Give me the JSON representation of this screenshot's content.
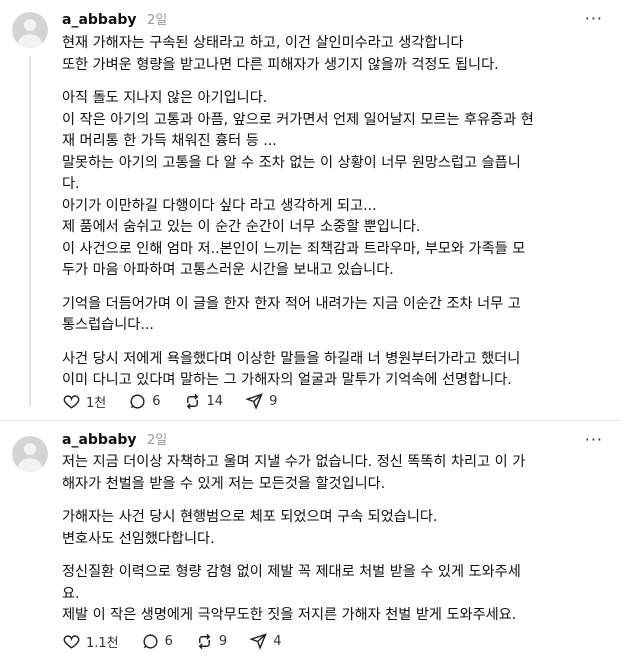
{
  "posts": [
    {
      "username": "a_abbaby",
      "time": "2일",
      "more_label": "···",
      "paragraphs": [
        {
          "lines": [
            "현재 가해자는 구속된 상태라고 하고, 이건 살인미수라고 생각합니다",
            "또한 가벼운 형량을 받고나면 다른 피해자가 생기지 않을까 걱정도 됩니다."
          ]
        },
        {
          "lines": [
            "아직 돌도 지나지 않은 아기입니다.",
            "이 작은 아기의 고통과 아픔, 앞으로 커가면서 언제 일어날지 모르는 후유증과 현",
            "재 머리통 한 가득 채워진 흉터 등 ...",
            "말못하는 아기의 고통을 다 알 수 조차 없는 이 상황이 너무 원망스럽고 슬픕니",
            "다.",
            "아기가 이만하길 다행이다 싶다 라고 생각하게 되고...",
            "제 품에서 숨쉬고 있는 이 순간 순간이 너무 소중할 뿐입니다.",
            "이 사건으로 인해 엄마 저..본인이 느끼는 죄책감과 트라우마, 부모와 가족들 모",
            "두가 마음 아파하며 고통스러운 시간을 보내고 있습니다."
          ]
        },
        {
          "lines": [
            "기억을 더듬어가며 이 글을 한자 한자 적어 내려가는 지금 이순간 조차 너무 고",
            "통스럽습니다..."
          ]
        },
        {
          "lines": [
            "사건 당시 저에게 욕을했다며 이상한 말들을 하길래 너 병원부터가라고 했더니",
            "이미 다니고 있다며 말하는 그 가해자의 얼굴과 말투가 기억속에 선명합니다."
          ]
        }
      ],
      "actions": {
        "likes": "1천",
        "comments": "6",
        "reposts": "14",
        "shares": "9"
      }
    },
    {
      "username": "a_abbaby",
      "time": "2일",
      "more_label": "···",
      "paragraphs": [
        {
          "lines": [
            "저는 지금 더이상 자책하고 울며 지낼 수가 없습니다. 정신 똑똑히 차리고 이 가",
            "해자가 천벌을 받을 수 있게 저는 모든것을 할것입니다."
          ]
        },
        {
          "lines": [
            "가해자는 사건 당시 현행범으로 체포 되었으며 구속 되었습니다.",
            "변호사도 선임했다합니다."
          ]
        },
        {
          "lines": [
            "정신질환 이력으로 형량 감형 없이 제발 꼭 제대로 처벌 받을 수 있게 도와주세",
            "요.",
            "제발 이 작은 생명에게 극악무도한 짓을 저지른 가해자 천벌 받게 도와주세요."
          ]
        }
      ],
      "actions": {
        "likes": "1.1천",
        "comments": "6",
        "reposts": "9",
        "shares": "4"
      }
    }
  ],
  "icons": [
    "avatar",
    "more-icon",
    "heart-icon",
    "comment-icon",
    "repost-icon",
    "share-icon"
  ]
}
